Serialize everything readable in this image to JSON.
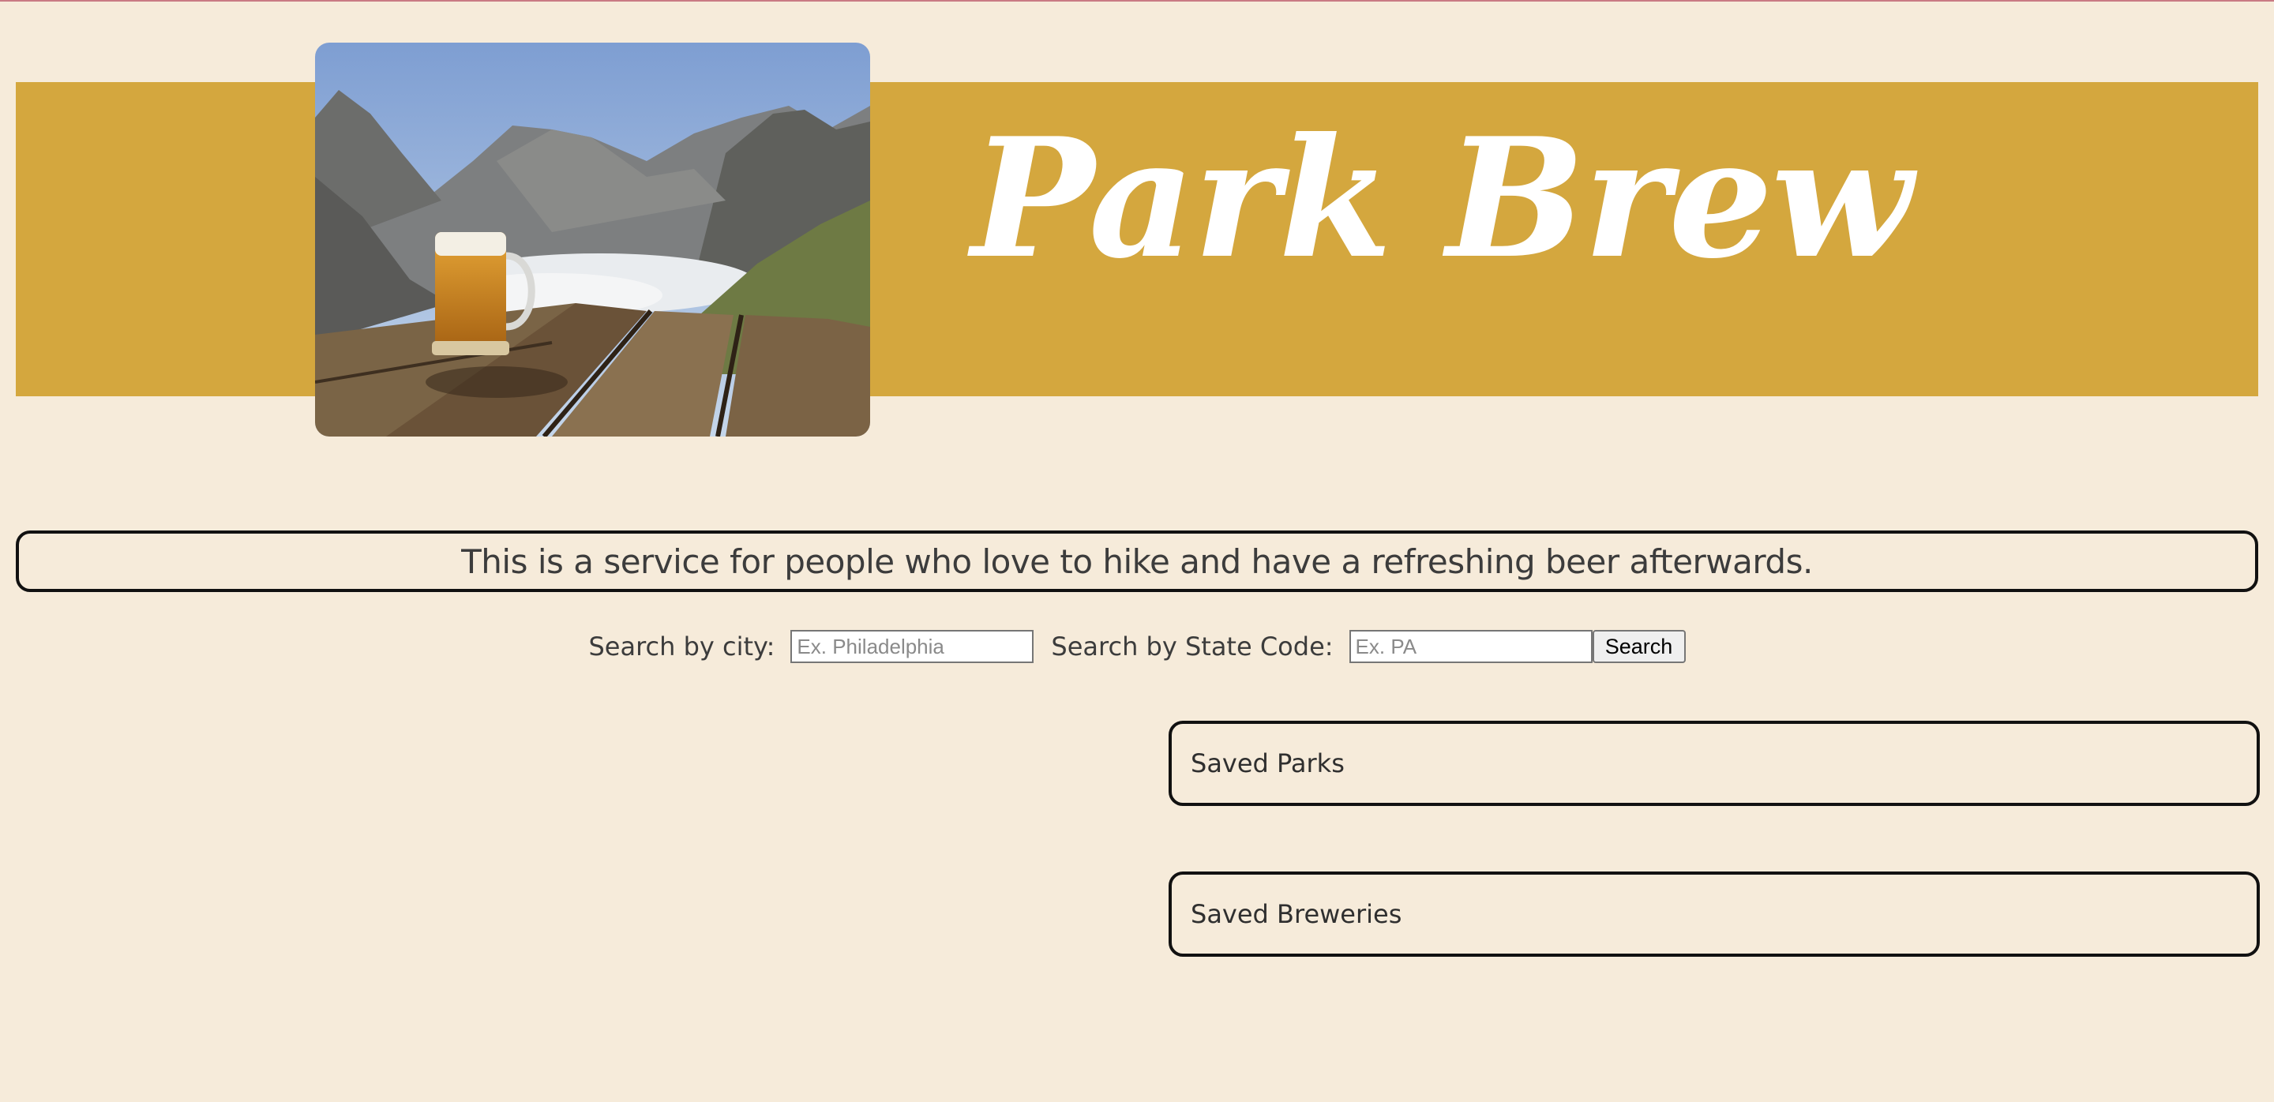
{
  "header": {
    "title": "Park Brew",
    "banner_color": "#d4a73e"
  },
  "hero_image": {
    "icon": "mountain-beer-photo"
  },
  "tagline": "This is a service for people who love to hike and have a refreshing beer afterwards.",
  "search": {
    "city_label": "Search by city:",
    "city_placeholder": "Ex. Philadelphia",
    "state_label": "Search by State Code:",
    "state_placeholder": "Ex. PA",
    "button_label": "Search"
  },
  "saved": {
    "parks_label": "Saved Parks",
    "breweries_label": "Saved Breweries"
  },
  "colors": {
    "background": "#f6ebda",
    "banner": "#d4a73e",
    "title": "#ffffff",
    "border": "#111111"
  }
}
